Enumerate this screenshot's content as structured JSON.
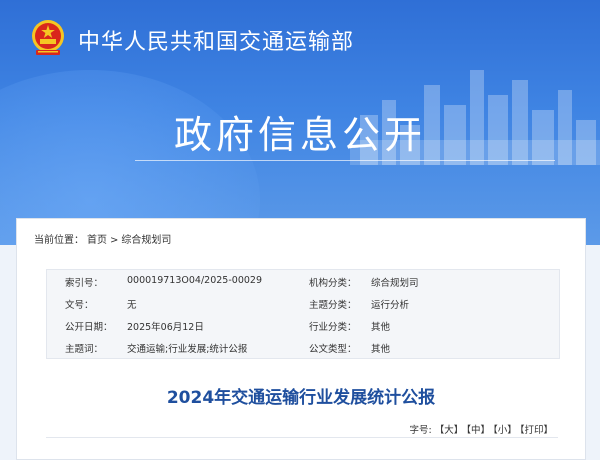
{
  "header": {
    "ministry_name": "中华人民共和国交通运输部",
    "section_title": "政府信息公开"
  },
  "breadcrumb": {
    "prefix": "当前位置：",
    "home": "首页",
    "separator": ">",
    "current": "综合规划司"
  },
  "meta": {
    "rows": [
      {
        "label1": "索引号：",
        "value1": "000019713O04/2025-00029",
        "label2": "机构分类：",
        "value2": "综合规划司"
      },
      {
        "label1": "文号：",
        "value1": "无",
        "label2": "主题分类：",
        "value2": "运行分析"
      },
      {
        "label1": "公开日期：",
        "value1": "2025年06月12日",
        "label2": "行业分类：",
        "value2": "其他"
      },
      {
        "label1": "主题词：",
        "value1": "交通运输;行业发展;统计公报",
        "label2": "公文类型：",
        "value2": "其他"
      }
    ]
  },
  "article": {
    "title": "2024年交通运输行业发展统计公报"
  },
  "font_size": {
    "label": "字号:",
    "large": "【大】",
    "medium": "【中】",
    "small": "【小】",
    "print": "【打印】"
  },
  "colors": {
    "hero_blue": "#3f84e3",
    "title_blue": "#1f4f9e",
    "emblem_red": "#d9271c",
    "emblem_gold": "#f5c623"
  }
}
